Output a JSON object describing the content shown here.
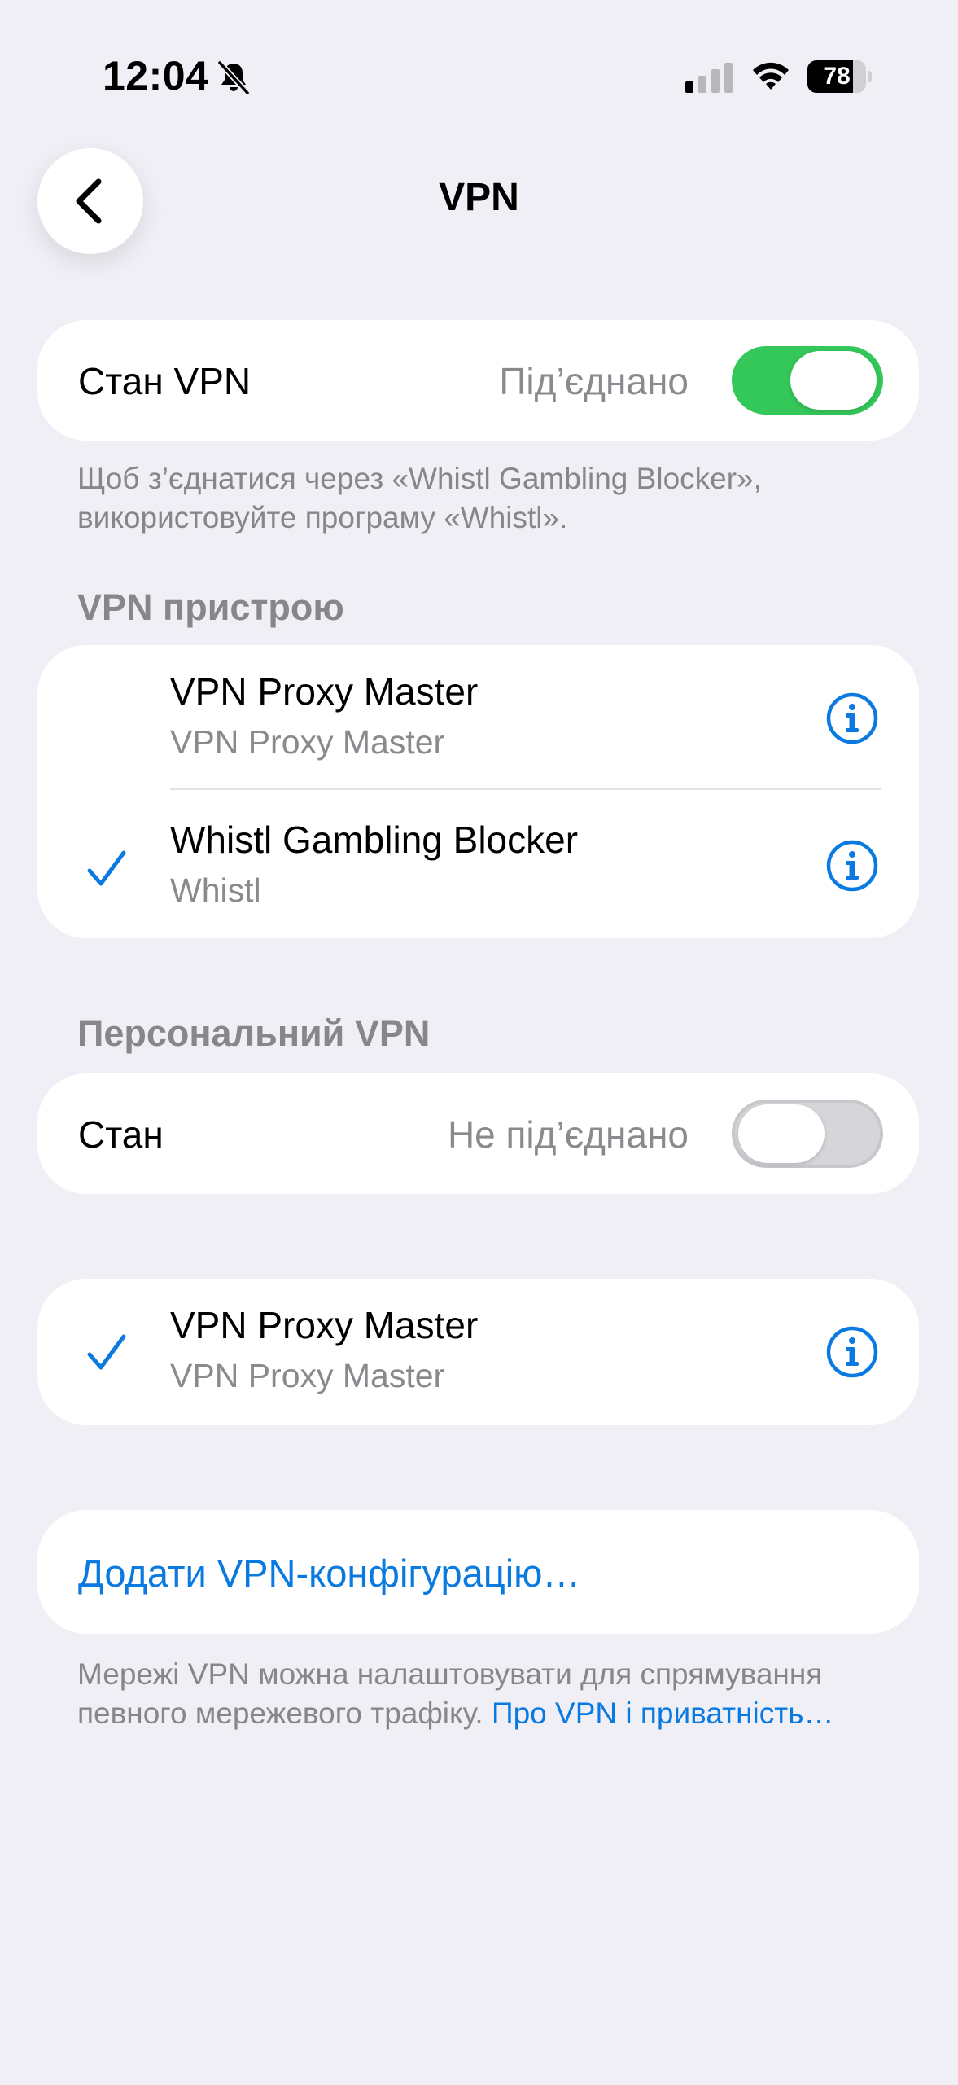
{
  "status_bar": {
    "time": "12:04",
    "battery_level": "78",
    "battery_fraction": 0.78,
    "icons": [
      "bell-slash-icon",
      "signal-icon",
      "wifi-icon",
      "battery-icon"
    ]
  },
  "nav": {
    "title": "VPN",
    "back_icon": "chevron-left-icon"
  },
  "vpn_status": {
    "label": "Стан VPN",
    "value": "Під’єднано",
    "toggle_on": true,
    "note": "Щоб з’єднатися через «Whistl Gambling Blocker», використовуйте програму «Whistl»."
  },
  "device_vpn": {
    "header": "VPN пристрою",
    "items": [
      {
        "title": "VPN Proxy Master",
        "subtitle": "VPN Proxy Master",
        "selected": false
      },
      {
        "title": "Whistl Gambling Blocker",
        "subtitle": "Whistl",
        "selected": true
      }
    ]
  },
  "personal_vpn": {
    "header": "Персональний VPN",
    "status_label": "Стан",
    "status_value": "Не під’єднано",
    "toggle_on": false,
    "items": [
      {
        "title": "VPN Proxy Master",
        "subtitle": "VPN Proxy Master",
        "selected": true
      }
    ]
  },
  "add_config": {
    "label": "Додати VPN-конфігурацію…"
  },
  "footer": {
    "text": "Мережі VPN можна налаштовувати для спрямування певного мережевого трафіку. ",
    "link": "Про VPN і приватність…"
  },
  "colors": {
    "background": "#f0eff5",
    "accent": "#0a7ae0",
    "toggle_on": "#34c759",
    "secondary_text": "#8a8a8e"
  }
}
